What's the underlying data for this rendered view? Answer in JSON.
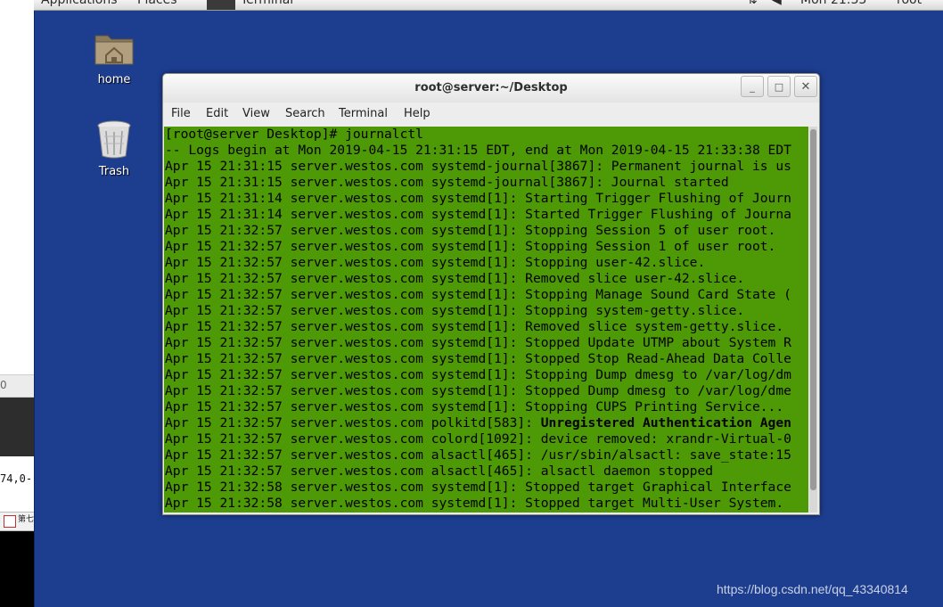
{
  "top_panel": {
    "applications": "Applications",
    "places": "Places",
    "task": "Terminal",
    "clock": "Mon 21:33",
    "user": "root"
  },
  "left_strip": {
    "ruler": "0",
    "position": "74,0-",
    "tab": "第七"
  },
  "desktop": {
    "icons": [
      {
        "label": "home",
        "icon": "folder-home-icon"
      },
      {
        "label": "Trash",
        "icon": "trash-icon"
      }
    ]
  },
  "window": {
    "title": "root@server:~/Desktop",
    "buttons": {
      "minimize": "_",
      "maximize": "□",
      "close": "✕"
    },
    "menu": [
      "File",
      "Edit",
      "View",
      "Search",
      "Terminal",
      "Help"
    ]
  },
  "terminal": {
    "background": "#4e9a06",
    "lines": [
      "[root@server Desktop]# journalctl",
      "-- Logs begin at Mon 2019-04-15 21:31:15 EDT, end at Mon 2019-04-15 21:33:38 EDT",
      "Apr 15 21:31:15 server.westos.com systemd-journal[3867]: Permanent journal is us",
      "Apr 15 21:31:15 server.westos.com systemd-journal[3867]: Journal started",
      "Apr 15 21:31:14 server.westos.com systemd[1]: Starting Trigger Flushing of Journ",
      "Apr 15 21:31:14 server.westos.com systemd[1]: Started Trigger Flushing of Journa",
      "Apr 15 21:32:57 server.westos.com systemd[1]: Stopping Session 5 of user root.",
      "Apr 15 21:32:57 server.westos.com systemd[1]: Stopping Session 1 of user root.",
      "Apr 15 21:32:57 server.westos.com systemd[1]: Stopping user-42.slice.",
      "Apr 15 21:32:57 server.westos.com systemd[1]: Removed slice user-42.slice.",
      "Apr 15 21:32:57 server.westos.com systemd[1]: Stopping Manage Sound Card State (",
      "Apr 15 21:32:57 server.westos.com systemd[1]: Stopping system-getty.slice.",
      "Apr 15 21:32:57 server.westos.com systemd[1]: Removed slice system-getty.slice.",
      "Apr 15 21:32:57 server.westos.com systemd[1]: Stopped Update UTMP about System R",
      "Apr 15 21:32:57 server.westos.com systemd[1]: Stopped Stop Read-Ahead Data Colle",
      "Apr 15 21:32:57 server.westos.com systemd[1]: Stopping Dump dmesg to /var/log/dm",
      "Apr 15 21:32:57 server.westos.com systemd[1]: Stopped Dump dmesg to /var/log/dme",
      "Apr 15 21:32:57 server.westos.com systemd[1]: Stopping CUPS Printing Service...",
      {
        "prefix": "Apr 15 21:32:57 server.westos.com polkitd[583]: ",
        "bold": "Unregistered Authentication Agen"
      },
      "Apr 15 21:32:57 server.westos.com colord[1092]: device removed: xrandr-Virtual-0",
      "Apr 15 21:32:57 server.westos.com alsactl[465]: /usr/sbin/alsactl: save_state:15",
      "Apr 15 21:32:57 server.westos.com alsactl[465]: alsactl daemon stopped",
      "Apr 15 21:32:58 server.westos.com systemd[1]: Stopped target Graphical Interface",
      "Apr 15 21:32:58 server.westos.com systemd[1]: Stopped target Multi-User System."
    ]
  },
  "watermark": "https://blog.csdn.net/qq_43340814"
}
